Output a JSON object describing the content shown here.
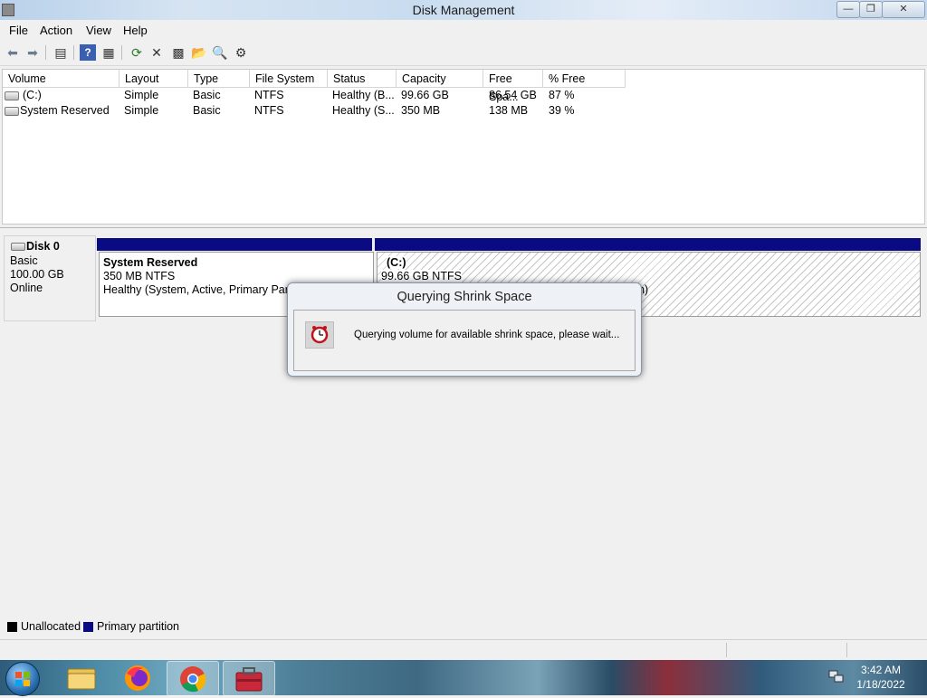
{
  "window": {
    "title": "Disk Management",
    "min_icon": "minimize-icon",
    "max_icon": "restore-icon",
    "close_icon": "close-icon"
  },
  "menu": [
    "File",
    "Action",
    "View",
    "Help"
  ],
  "toolbar_icons": [
    "back-arrow-icon",
    "forward-arrow-icon",
    "console-tree-icon",
    "help-icon",
    "properties-grid-icon",
    "refresh-icon",
    "delete-icon",
    "properties-icon",
    "open-folder-icon",
    "search-icon",
    "settings-icon"
  ],
  "volume_list": {
    "columns": [
      "Volume",
      "Layout",
      "Type",
      "File System",
      "Status",
      "Capacity",
      "Free Spa...",
      "% Free"
    ],
    "rows": [
      [
        "(C:)",
        "Simple",
        "Basic",
        "NTFS",
        "Healthy (B...",
        "99.66 GB",
        "86.54 GB",
        "87 %"
      ],
      [
        "System Reserved",
        "Simple",
        "Basic",
        "NTFS",
        "Healthy (S...",
        "350 MB",
        "138 MB",
        "39 %"
      ]
    ]
  },
  "disk": {
    "name": "Disk 0",
    "type": "Basic",
    "size": "100.00 GB",
    "state": "Online",
    "partitions": [
      {
        "name": "System Reserved",
        "size": "350 MB NTFS",
        "status": "Healthy (System, Active, Primary Partiti"
      },
      {
        "name": "(C:)",
        "size": "99.66 GB NTFS",
        "status": "n)"
      }
    ]
  },
  "legend": [
    {
      "label": "Unallocated",
      "color": "#000000"
    },
    {
      "label": "Primary partition",
      "color": "#0a0a82"
    }
  ],
  "dialog": {
    "title": "Querying Shrink Space",
    "message": "Querying volume for available shrink space, please wait...",
    "icon": "clock-icon"
  },
  "taskbar": {
    "time": "3:42 AM",
    "date": "1/18/2022",
    "apps": [
      "start-orb-icon",
      "file-explorer-icon",
      "firefox-icon",
      "chrome-icon",
      "toolbox-icon"
    ]
  }
}
